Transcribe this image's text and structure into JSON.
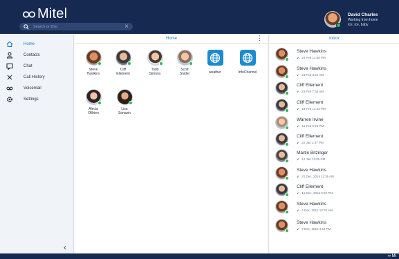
{
  "app": {
    "brand": "Mitel"
  },
  "search": {
    "placeholder": "Search or Dial"
  },
  "profile": {
    "name": "David Charles",
    "status_line1": "Working from home",
    "status_line2": "Ice, ice, baby"
  },
  "sidebar": {
    "items": [
      {
        "label": "Home",
        "icon": "home-icon",
        "active": true
      },
      {
        "label": "Contacts",
        "icon": "person-icon",
        "active": false
      },
      {
        "label": "Chat",
        "icon": "chat-icon",
        "active": false
      },
      {
        "label": "Call History",
        "icon": "call-history-icon",
        "active": false
      },
      {
        "label": "Voicemail",
        "icon": "voicemail-icon",
        "active": false
      },
      {
        "label": "Settings",
        "icon": "gear-icon",
        "active": false
      }
    ],
    "collapse_icon": "chevron-left-icon"
  },
  "home": {
    "title": "Home",
    "contacts": [
      {
        "first": "Steve",
        "last": "Hawkins"
      },
      {
        "first": "Cliff",
        "last": "Ellement"
      },
      {
        "first": "Todd",
        "last": "Simons"
      },
      {
        "first": "Scott",
        "last": "Snider"
      },
      {
        "first": "weather",
        "last": ""
      },
      {
        "first": "InfoChannel",
        "last": ""
      },
      {
        "first": "Alecia",
        "last": "OBrien"
      },
      {
        "first": "Lisa",
        "last": "Sonazin"
      }
    ]
  },
  "inbox": {
    "title": "Inbox",
    "items": [
      {
        "name": "Steve Hawkins",
        "time": "24 Feb 12:58 PM"
      },
      {
        "name": "Steve Hawkins",
        "time": "24 Feb 8:21 AM"
      },
      {
        "name": "Cliff Ellement",
        "time": "23 Feb 7:55 AM"
      },
      {
        "name": "Cliff Ellement",
        "time": "18 Feb 12:33 PM"
      },
      {
        "name": "Warren Irvine",
        "time": "16 Feb 2:24 PM"
      },
      {
        "name": "Cliff Ellement",
        "time": "22 Jan 2:37 PM"
      },
      {
        "name": "Martin Bitzinger",
        "time": "12 Jan 12:05 PM"
      },
      {
        "name": "Steve Hawkins",
        "time": "21 Dec, 2015 11:36 AM"
      },
      {
        "name": "Cliff Ellement",
        "time": "15 Dec, 2015 5:29 PM"
      },
      {
        "name": "Steve Hawkins",
        "time": "4 Dec, 2015 10:02 AM"
      },
      {
        "name": "Steve Hawkins",
        "time": "3 Dec, 2015 4:14 PM"
      }
    ]
  },
  "footer": {
    "brand": "Mi"
  },
  "colors": {
    "header": "#152951",
    "accent": "#1a7ec4",
    "presence": "#2dbb57",
    "tile": "#1b8ccf"
  }
}
